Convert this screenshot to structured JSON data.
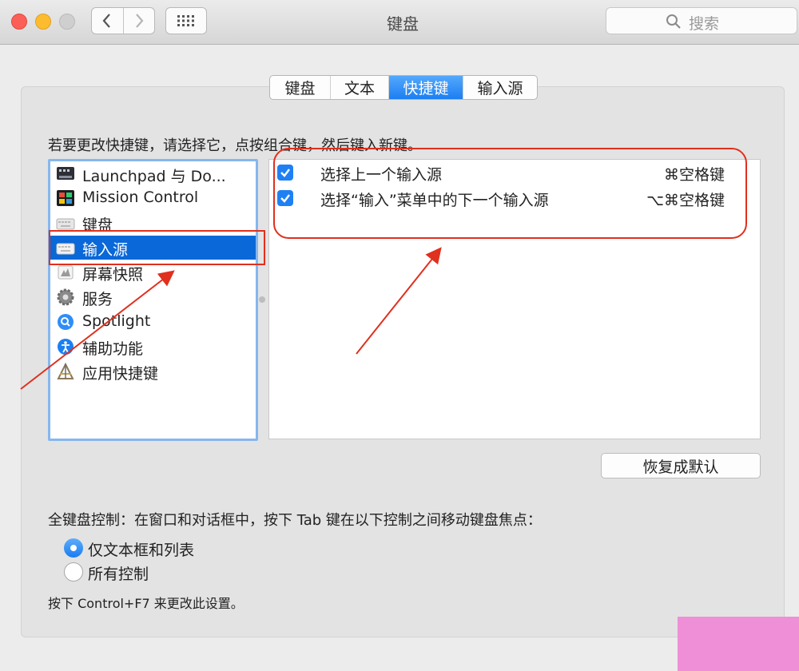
{
  "window": {
    "title": "键盘",
    "search_placeholder": "搜索"
  },
  "tabs": [
    {
      "label": "键盘",
      "active": false
    },
    {
      "label": "文本",
      "active": false
    },
    {
      "label": "快捷键",
      "active": true
    },
    {
      "label": "输入源",
      "active": false
    }
  ],
  "instruction": "若要更改快捷键，请选择它，点按组合键，然后键入新键。",
  "categories": [
    {
      "label": "Launchpad 与 Do...",
      "icon": "launchpad-icon"
    },
    {
      "label": "Mission Control",
      "icon": "mission-control-icon"
    },
    {
      "label": "键盘",
      "icon": "keyboard-icon"
    },
    {
      "label": "输入源",
      "icon": "input-source-icon",
      "selected": true
    },
    {
      "label": "屏幕快照",
      "icon": "screenshot-icon"
    },
    {
      "label": "服务",
      "icon": "gear-icon"
    },
    {
      "label": "Spotlight",
      "icon": "spotlight-icon"
    },
    {
      "label": "辅助功能",
      "icon": "accessibility-icon"
    },
    {
      "label": "应用快捷键",
      "icon": "app-shortcuts-icon"
    }
  ],
  "shortcuts": [
    {
      "label": "选择上一个输入源",
      "keys": "⌘空格键",
      "checked": true
    },
    {
      "label": "选择“输入”菜单中的下一个输入源",
      "keys": "⌥⌘空格键",
      "checked": true
    }
  ],
  "restore_button": "恢复成默认",
  "full_keyboard_access": {
    "label": "全键盘控制：在窗口和对话框中，按下 Tab 键在以下控制之间移动键盘焦点：",
    "options": [
      {
        "label": "仅文本框和列表",
        "selected": true
      },
      {
        "label": "所有控制",
        "selected": false
      }
    ],
    "hint": "按下 Control+F7 来更改此设置。"
  },
  "colors": {
    "accent": "#1c7ef3",
    "selection": "#0a68d8",
    "annotation": "#e0301e"
  }
}
